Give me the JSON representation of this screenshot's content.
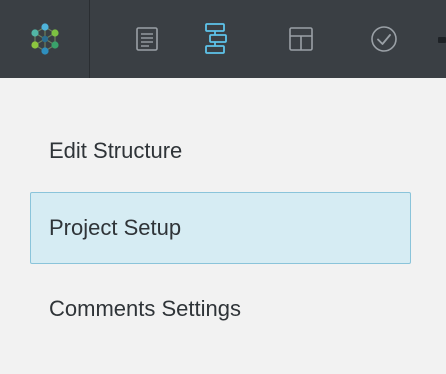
{
  "toolbar": {
    "logo": {
      "icon": "hex-network-logo-icon"
    },
    "buttons": [
      {
        "icon": "document-lines-icon",
        "color": "#9aa0a6",
        "active": false
      },
      {
        "icon": "structure-tree-icon",
        "color": "#5ec4ea",
        "active": true
      },
      {
        "icon": "layout-panels-icon",
        "color": "#9aa0a6",
        "active": false
      },
      {
        "icon": "check-circle-icon",
        "color": "#9aa0a6",
        "active": false
      }
    ]
  },
  "menu": {
    "items": [
      {
        "label": "Edit Structure",
        "selected": false
      },
      {
        "label": "Project Setup",
        "selected": true
      },
      {
        "label": "Comments Settings",
        "selected": false
      }
    ]
  },
  "colors": {
    "toolbar_bg": "#3a3f44",
    "page_bg": "#f2f2f2",
    "accent": "#5ec4ea",
    "selected_bg": "#d6ecf3",
    "selected_border": "#8ac4da",
    "text": "#2f3438"
  }
}
